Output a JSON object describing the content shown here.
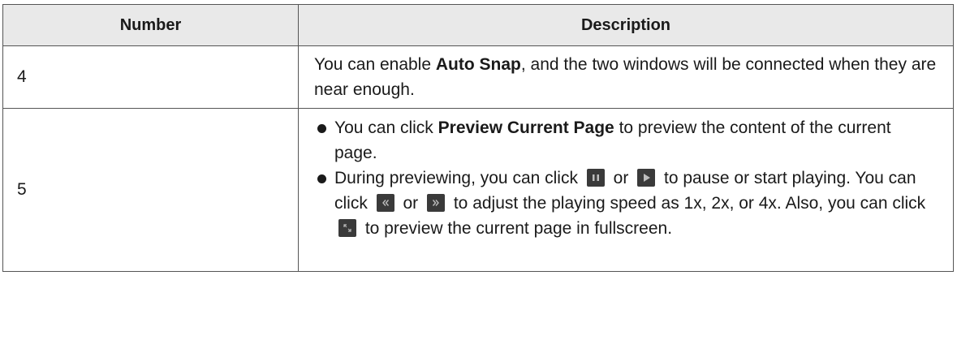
{
  "table": {
    "headers": {
      "number": "Number",
      "description": "Description"
    },
    "row4": {
      "number": "4",
      "text_before": "You can enable ",
      "bold": "Auto Snap",
      "text_after": ", and the two windows will be connected when they are near enough."
    },
    "row5": {
      "number": "5",
      "bullet1": {
        "text_before": "You can click ",
        "bold": "Preview Current Page",
        "text_after": " to preview the content of the current page."
      },
      "bullet2": {
        "part1": "During previewing, you can click ",
        "part2": " or ",
        "part3": " to pause or start playing. You can click ",
        "part4": " or ",
        "part5": " to adjust the playing speed as 1x, 2x, or 4x. Also, you can click ",
        "part6": " to preview the current page in fullscreen."
      }
    }
  },
  "icons": {
    "pause": "pause-icon",
    "play": "play-icon",
    "slower": "rewind-icon",
    "faster": "fast-forward-icon",
    "fullscreen": "fullscreen-icon",
    "icon_bg_color": "#3a3a3a",
    "glyph_color": "#bdbdbd"
  }
}
